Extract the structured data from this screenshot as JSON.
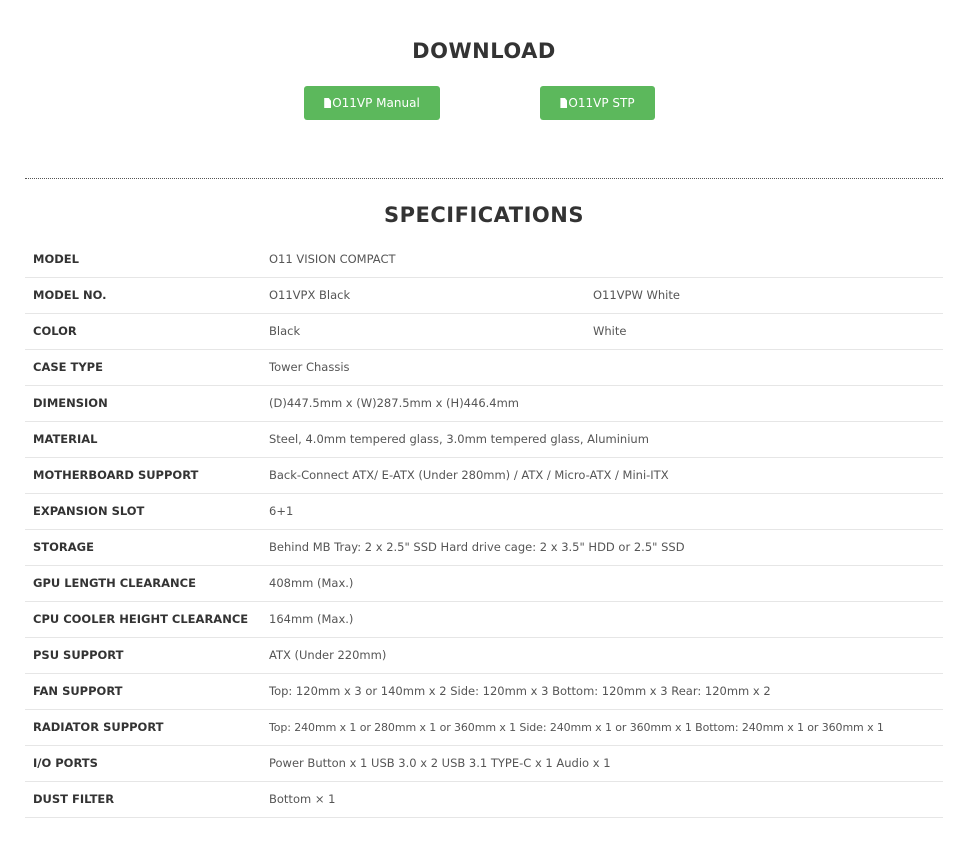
{
  "download": {
    "title": "DOWNLOAD",
    "buttons": [
      {
        "label": "O11VP Manual",
        "icon": "file-icon"
      },
      {
        "label": "O11VP STP",
        "icon": "file-icon"
      }
    ],
    "button_color": "#5cb85c"
  },
  "specifications": {
    "title": "SPECIFICATIONS",
    "rows": [
      {
        "label": "MODEL",
        "value": "O11 VISION COMPACT"
      },
      {
        "label": "MODEL NO.",
        "value": "O11VPX Black",
        "value2": "O11VPW White"
      },
      {
        "label": "COLOR",
        "value": "Black",
        "value2": "White"
      },
      {
        "label": "CASE TYPE",
        "value": "Tower Chassis"
      },
      {
        "label": "DIMENSION",
        "value": "(D)447.5mm x (W)287.5mm x (H)446.4mm"
      },
      {
        "label": "MATERIAL",
        "value": "Steel, 4.0mm tempered glass, 3.0mm tempered glass, Aluminium"
      },
      {
        "label": "MOTHERBOARD SUPPORT",
        "value": "Back-Connect ATX/ E-ATX (Under 280mm) / ATX / Micro-ATX / Mini-ITX"
      },
      {
        "label": "EXPANSION SLOT",
        "value": "6+1"
      },
      {
        "label": "STORAGE",
        "value": "Behind MB Tray: 2 x 2.5\" SSD Hard drive cage: 2 x 3.5\" HDD or 2.5\" SSD"
      },
      {
        "label": "GPU LENGTH CLEARANCE",
        "value": "408mm (Max.)"
      },
      {
        "label": "CPU COOLER HEIGHT CLEARANCE",
        "value": "164mm (Max.)"
      },
      {
        "label": "PSU SUPPORT",
        "value": "ATX (Under 220mm)"
      },
      {
        "label": "FAN SUPPORT",
        "value": "Top: 120mm x 3 or 140mm x 2 Side: 120mm x 3 Bottom: 120mm x 3 Rear: 120mm x 2"
      },
      {
        "label": "RADIATOR SUPPORT",
        "value": "Top: 240mm x 1 or 280mm x 1 or 360mm x 1 Side: 240mm x 1 or 360mm x 1 Bottom: 240mm x 1 or 360mm x 1"
      },
      {
        "label": "I/O PORTS",
        "value": "Power Button x 1 USB 3.0 x 2 USB 3.1 TYPE-C x 1 Audio x 1"
      },
      {
        "label": "DUST FILTER",
        "value": "Bottom × 1"
      }
    ]
  }
}
